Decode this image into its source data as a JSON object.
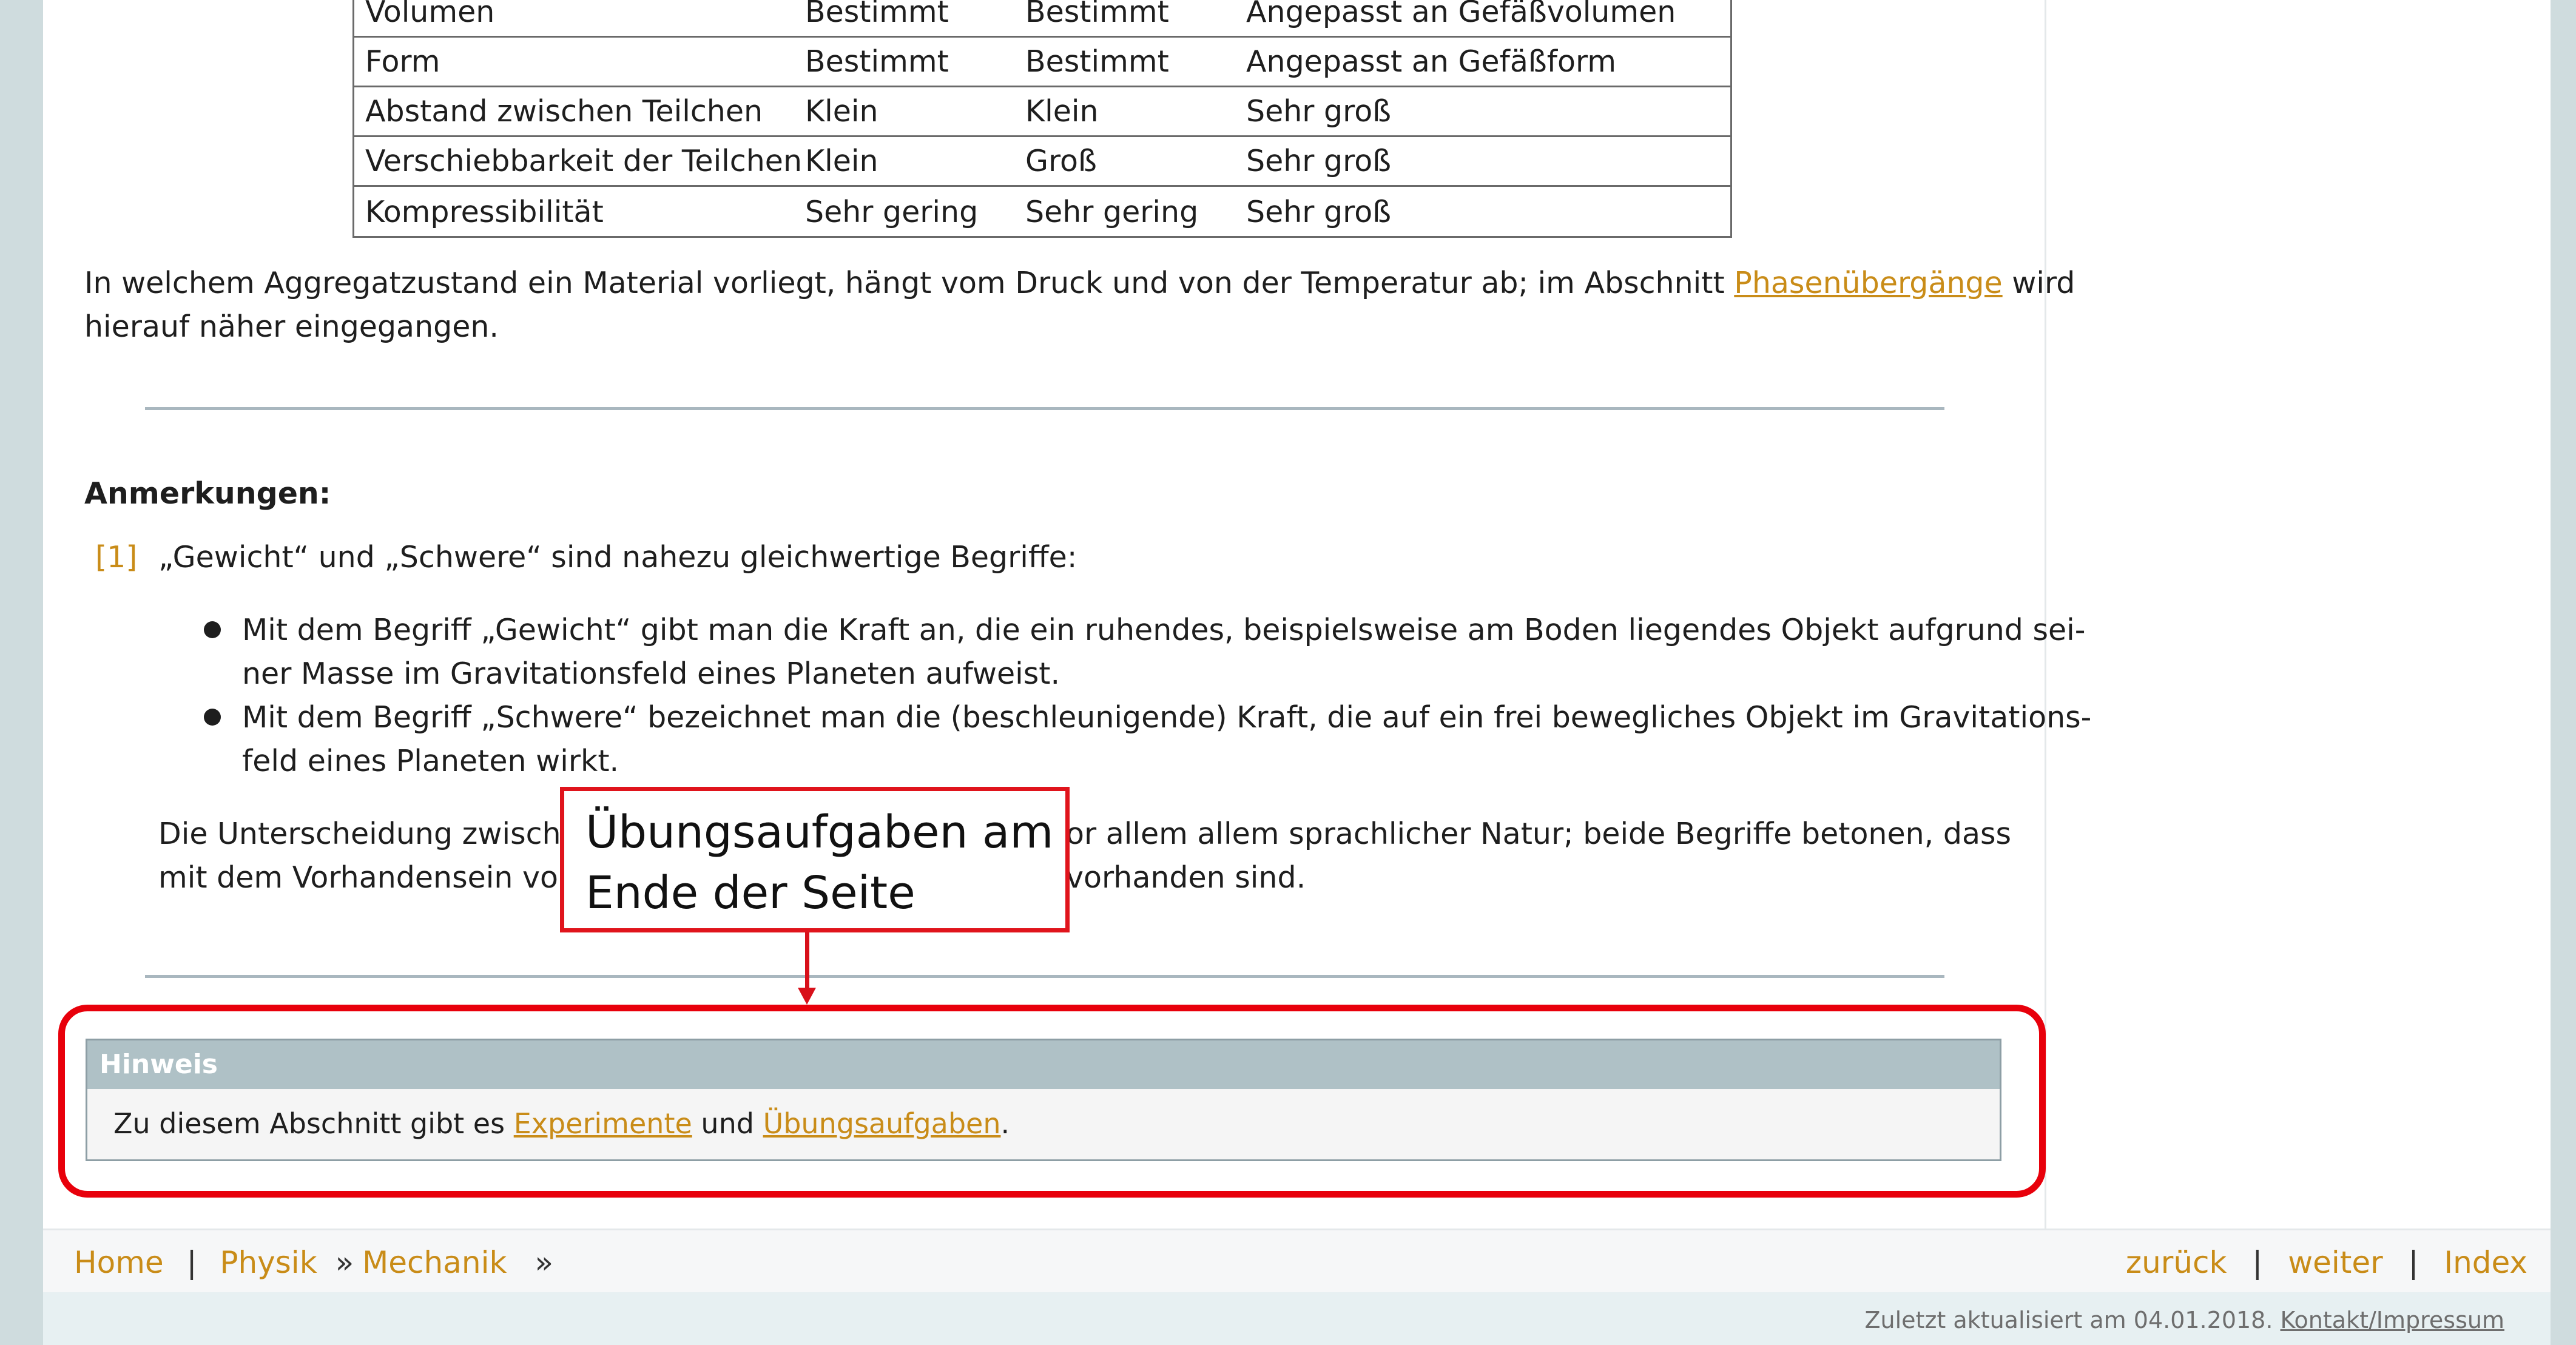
{
  "table": {
    "rows": [
      [
        "Volumen",
        "Bestimmt",
        "Bestimmt",
        "Angepasst an Gefäßvolumen"
      ],
      [
        "Form",
        "Bestimmt",
        "Bestimmt",
        "Angepasst an Gefäßform"
      ],
      [
        "Abstand zwischen Teilchen",
        "Klein",
        "Klein",
        "Sehr groß"
      ],
      [
        "Verschiebbarkeit der Teilchen",
        "Klein",
        "Groß",
        "Sehr groß"
      ],
      [
        "Kompressibilität",
        "Sehr gering",
        "Sehr gering",
        "Sehr groß"
      ]
    ]
  },
  "intro": {
    "line1_before": "In welchem Aggregatzustand ein Material vorliegt, hängt vom Druck und von der Temperatur ab; im Abschnitt ",
    "link": "Phasenübergänge",
    "line1_after": " wird",
    "line2": "hierauf näher eingegangen."
  },
  "notes": {
    "heading": "Anmerkungen:",
    "ref": "[1]",
    "text": "„Gewicht“ und „Schwere“ sind nahezu gleichwertige Begriffe:",
    "bullets": [
      [
        "Mit dem Begriff „Gewicht“ gibt man die Kraft an, die ein ruhendes, beispielsweise am Boden liegendes Objekt aufgrund sei-",
        "ner Masse im Gravitationsfeld eines Planeten aufweist."
      ],
      [
        "Mit dem Begriff „Schwere“ bezeichnet man die (beschleunigende) Kraft, die auf ein frei bewegliches Objekt im Gravitations-",
        "feld eines Planeten wirkt."
      ]
    ],
    "para_line1_left": "Die Unterscheidung zwischen",
    "para_line1_right": "or allem allem sprachlicher Natur; beide Begriffe betonen, dass",
    "para_line2_left": "mit dem Vorhandensein von",
    "para_line2_right": "vorhanden sind."
  },
  "callout": {
    "line1": "Übungsaufgaben am",
    "line2": "Ende der Seite"
  },
  "hint": {
    "title": "Hinweis",
    "before": "Zu diesem Abschnitt gibt es ",
    "link1": "Experimente",
    "middle": " und ",
    "link2": "Übungsaufgaben",
    "after": "."
  },
  "footer": {
    "home": "Home",
    "sep": "|",
    "physik": "Physik",
    "chev": "»",
    "mechanik": "Mechanik",
    "back": "zurück",
    "next": "weiter",
    "index": "Index",
    "updated": "Zuletzt aktualisiert am 04.01.2018.",
    "contact": "Kontakt/Impressum"
  },
  "colors": {
    "accent_link": "#c98c18",
    "callout_red": "#e8000b",
    "hint_header": "#afc1c6"
  }
}
